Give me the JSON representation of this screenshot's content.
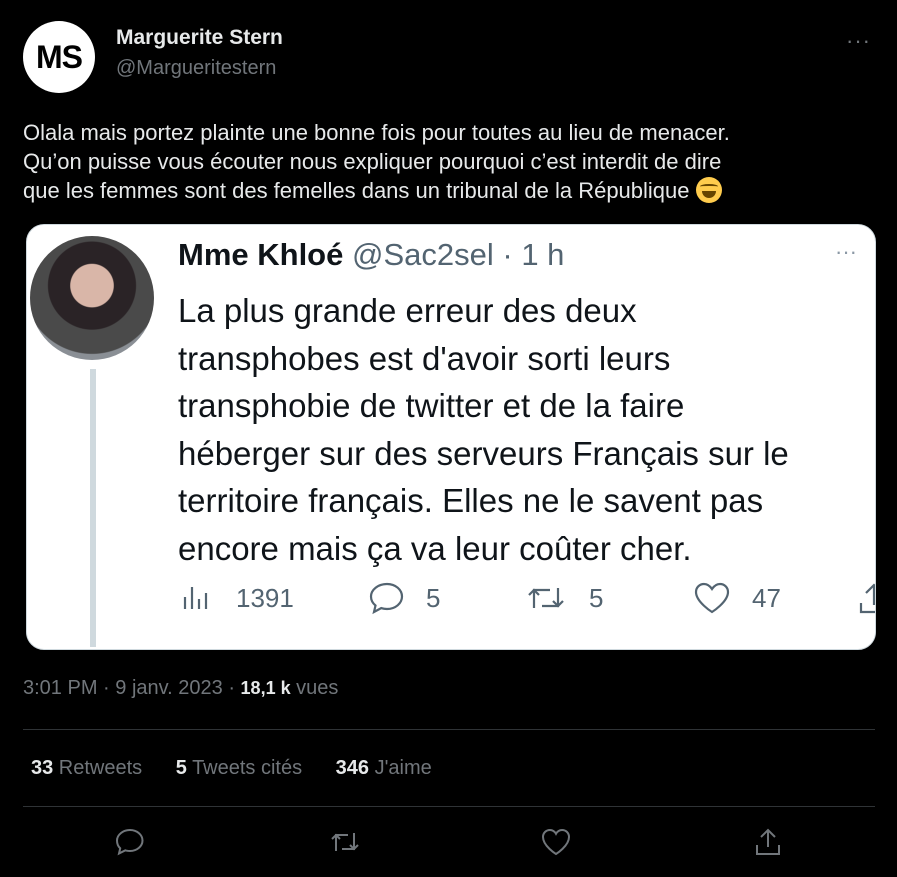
{
  "author": {
    "avatar_text": "MS",
    "name": "Marguerite Stern",
    "handle": "@Margueritestern",
    "more": "···"
  },
  "tweet": {
    "text_line1": "Olala mais portez plainte une bonne fois pour toutes au lieu de menacer.",
    "text_line2": "Qu’on puisse vous écouter nous expliquer pourquoi c’est interdit de dire",
    "text_line3": "que les femmes sont des femelles dans un tribunal de la République",
    "emoji": "face-with-tears-of-joy"
  },
  "quoted": {
    "name": "Mme Khloé",
    "handle": "@Sac2sel",
    "sep": " · ",
    "time": "1 h",
    "more": "···",
    "lines": [
      "La plus grande erreur des deux",
      "transphobes est d'avoir sorti leurs",
      "transphobie de twitter et de la faire",
      "héberger sur des serveurs Français sur le",
      "territoire français. Elles ne le savent pas",
      "encore mais ça va leur coûter cher."
    ],
    "stats": {
      "views": "1391",
      "replies": "5",
      "retweets": "5",
      "likes": "47"
    }
  },
  "meta": {
    "time": "3:01 PM",
    "sep1": " · ",
    "date": "9 janv. 2023",
    "sep2": " · ",
    "views_count": "18,1 k",
    "views_label": " vues"
  },
  "stats": {
    "retweets_count": "33",
    "retweets_label": " Retweets",
    "quotes_count": "5",
    "quotes_label": " Tweets cités",
    "likes_count": "346",
    "likes_label": " J'aime"
  }
}
